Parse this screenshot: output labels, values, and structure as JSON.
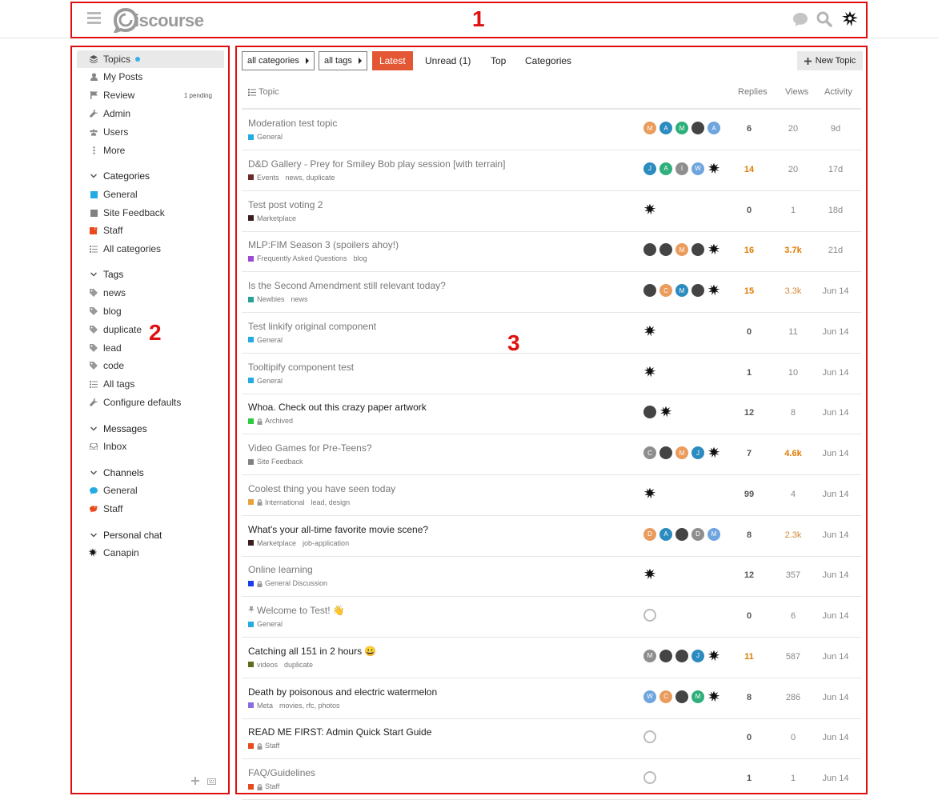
{
  "annotations": [
    "1",
    "2",
    "3"
  ],
  "header": {
    "logo_text": "iscourse"
  },
  "sidebar": {
    "items": [
      {
        "label": "Topics",
        "icon": "layers-icon"
      },
      {
        "label": "My Posts",
        "icon": "user-icon"
      },
      {
        "label": "Review",
        "icon": "flag-icon",
        "badge": "1 pending"
      },
      {
        "label": "Admin",
        "icon": "wrench-icon"
      },
      {
        "label": "Users",
        "icon": "users-icon"
      },
      {
        "label": "More",
        "icon": "ellipsis-icon"
      }
    ],
    "categories_header": "Categories",
    "categories": [
      {
        "label": "General",
        "color": "#25aae2"
      },
      {
        "label": "Site Feedback",
        "color": "#808281"
      },
      {
        "label": "Staff",
        "color": "#e9491f"
      },
      {
        "label": "All categories"
      }
    ],
    "tags_header": "Tags",
    "tags": [
      "news",
      "blog",
      "duplicate",
      "lead",
      "code",
      "All tags",
      "Configure defaults"
    ],
    "messages_header": "Messages",
    "messages": [
      "Inbox"
    ],
    "channels_header": "Channels",
    "channels": [
      "General",
      "Staff"
    ],
    "personal_chat_header": "Personal chat",
    "personal_chat": [
      "Canapin"
    ]
  },
  "nav": {
    "category_filter": "all categories",
    "tag_filter": "all tags",
    "tabs": [
      "Latest",
      "Unread (1)",
      "Top",
      "Categories"
    ],
    "new_topic": "New Topic"
  },
  "columns": {
    "topic": "Topic",
    "replies": "Replies",
    "views": "Views",
    "activity": "Activity"
  },
  "topics": [
    {
      "title": "Moderation test topic",
      "category": "General",
      "cat_color": "#25aae2",
      "tags": "",
      "replies": "6",
      "views": "20",
      "activity": "9d",
      "unread": false
    },
    {
      "title": "D&D Gallery - Prey for Smiley Bob play session [with terrain]",
      "category": "Events",
      "cat_color": "#6d2a2a",
      "tags": "news, duplicate",
      "replies": "14",
      "views": "20",
      "activity": "17d",
      "unread": false
    },
    {
      "title": "Test post voting 2",
      "category": "Marketplace",
      "cat_color": "#3d1e1e",
      "tags": "",
      "replies": "0",
      "views": "1",
      "activity": "18d",
      "unread": false
    },
    {
      "title": "MLP:FIM Season 3 (spoilers ahoy!)",
      "category": "Frequently Asked Questions",
      "cat_color": "#a04ad2",
      "tags": "blog",
      "replies": "16",
      "views": "3.7k",
      "activity": "21d",
      "unread": false
    },
    {
      "title": "Is the Second Amendment still relevant today?",
      "category": "Newbies",
      "cat_color": "#2aa198",
      "tags": "news",
      "replies": "15",
      "views": "3.3k",
      "activity": "Jun 14",
      "unread": false
    },
    {
      "title": "Test linkify original component",
      "category": "General",
      "cat_color": "#25aae2",
      "tags": "",
      "replies": "0",
      "views": "11",
      "activity": "Jun 14",
      "unread": false
    },
    {
      "title": "Tooltipify component test",
      "category": "General",
      "cat_color": "#25aae2",
      "tags": "",
      "replies": "1",
      "views": "10",
      "activity": "Jun 14",
      "unread": false
    },
    {
      "title": "Whoa. Check out this crazy paper artwork",
      "category": "Archived",
      "cat_color": "#2ecc40",
      "tags": "",
      "replies": "12",
      "views": "8",
      "activity": "Jun 14",
      "unread": true
    },
    {
      "title": "Video Games for Pre-Teens?",
      "category": "Site Feedback",
      "cat_color": "#808281",
      "tags": "",
      "replies": "7",
      "views": "4.6k",
      "activity": "Jun 14",
      "unread": false
    },
    {
      "title": "Coolest thing you have seen today",
      "category": "International",
      "cat_color": "#e8a13a",
      "tags": "lead, design",
      "replies": "99",
      "views": "4",
      "activity": "Jun 14",
      "unread": false
    },
    {
      "title": "What's your all-time favorite movie scene?",
      "category": "Marketplace",
      "cat_color": "#3d1e1e",
      "tags": "job-application",
      "replies": "8",
      "views": "2.3k",
      "activity": "Jun 14",
      "unread": true
    },
    {
      "title": "Online learning",
      "category": "General Discussion",
      "cat_color": "#1a3ee8",
      "tags": "",
      "replies": "12",
      "views": "357",
      "activity": "Jun 14",
      "unread": false
    },
    {
      "title": "Welcome to Test! 👋",
      "category": "General",
      "cat_color": "#25aae2",
      "tags": "",
      "replies": "0",
      "views": "6",
      "activity": "Jun 14",
      "unread": false
    },
    {
      "title": "Catching all 151 in 2 hours 😀",
      "category": "videos",
      "cat_color": "#5a6e1c",
      "tags": "duplicate",
      "replies": "11",
      "views": "587",
      "activity": "Jun 14",
      "unread": true
    },
    {
      "title": "Death by poisonous and electric watermelon",
      "category": "Meta",
      "cat_color": "#8c6ce0",
      "tags": "movies, rfc, photos",
      "replies": "8",
      "views": "286",
      "activity": "Jun 14",
      "unread": true
    },
    {
      "title": "READ ME FIRST: Admin Quick Start Guide",
      "category": "Staff",
      "cat_color": "#e9491f",
      "tags": "",
      "replies": "0",
      "views": "0",
      "activity": "Jun 14",
      "unread": true
    },
    {
      "title": "FAQ/Guidelines",
      "category": "Staff",
      "cat_color": "#e9491f",
      "tags": "",
      "replies": "1",
      "views": "1",
      "activity": "Jun 14",
      "unread": false
    }
  ],
  "poster_letters": [
    [
      "M",
      "A",
      "M",
      "",
      "A"
    ],
    [
      "J",
      "A",
      "I",
      "W",
      ""
    ],
    [
      ""
    ],
    [
      "",
      "",
      "M",
      "",
      ""
    ],
    [
      "",
      "C",
      "M",
      "",
      ""
    ],
    [
      ""
    ],
    [
      ""
    ],
    [
      "",
      ""
    ],
    [
      "C",
      "",
      "M",
      "J",
      ""
    ],
    [
      ""
    ],
    [
      "D",
      "A",
      "",
      "D",
      "M"
    ],
    [
      ""
    ],
    [
      ""
    ],
    [
      "M",
      "",
      "",
      "J",
      ""
    ],
    [
      "W",
      "C",
      "",
      "M",
      ""
    ],
    [
      ""
    ],
    [
      ""
    ]
  ]
}
